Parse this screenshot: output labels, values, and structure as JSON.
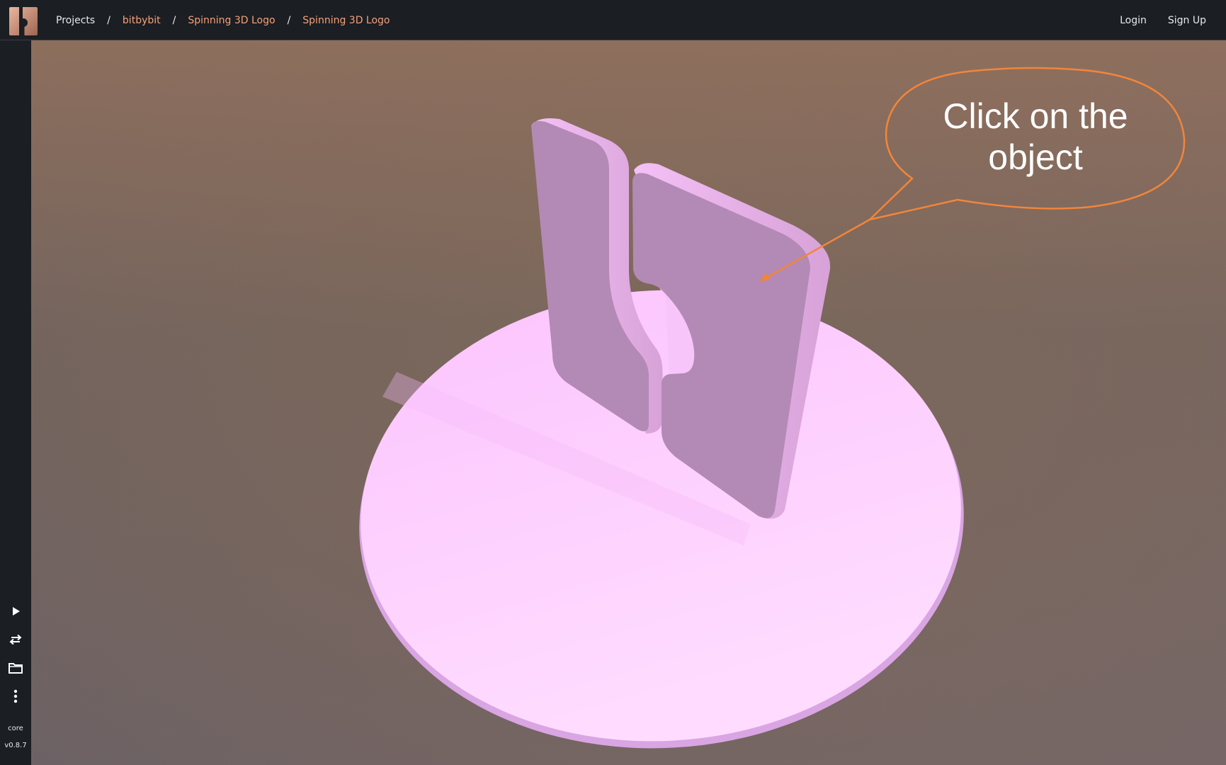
{
  "header": {
    "logo_alt": "bitbybit logo",
    "breadcrumbs": [
      {
        "label": "Projects",
        "accent": false
      },
      {
        "label": "bitbybit",
        "accent": true
      },
      {
        "label": "Spinning 3D Logo",
        "accent": true
      },
      {
        "label": "Spinning 3D Logo",
        "accent": true
      }
    ],
    "separator": "/",
    "login_label": "Login",
    "signup_label": "Sign Up"
  },
  "sidebar": {
    "buttons": [
      {
        "name": "run-button",
        "icon": "play-icon"
      },
      {
        "name": "swap-button",
        "icon": "swap-arrows-icon"
      },
      {
        "name": "open-folder-button",
        "icon": "folder-icon"
      },
      {
        "name": "more-button",
        "icon": "more-vertical-icon"
      }
    ],
    "engine_label": "core",
    "version_label": "v0.8.7"
  },
  "viewport": {
    "callout_text_line1": "Click on the",
    "callout_text_line2": "object",
    "callout_color": "#f2853a",
    "object_color": "#f9c8fb",
    "object_face_color": "#b48ab5"
  },
  "colors": {
    "topbar_bg": "#1b1e23",
    "accent": "#f3a27a"
  }
}
